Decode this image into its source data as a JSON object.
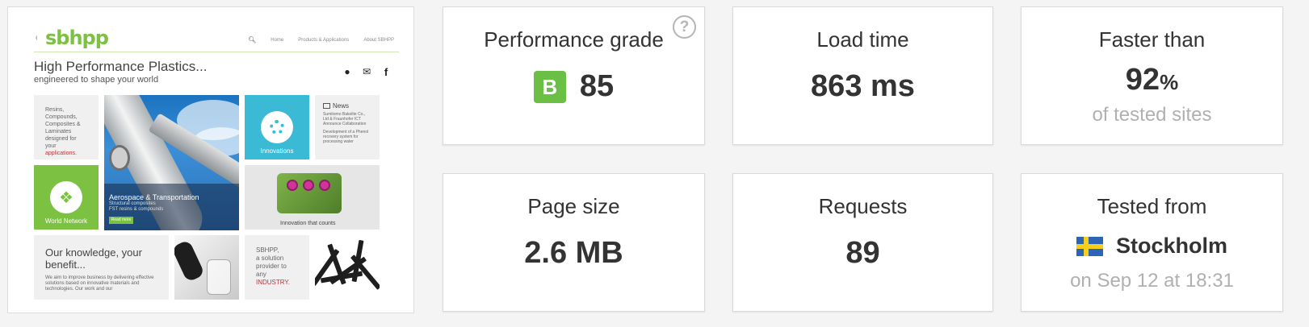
{
  "screenshot": {
    "logo": "sbhpp",
    "nav": [
      "Home",
      "Products & Applications",
      "About SBHPP"
    ],
    "headline": "High Performance Plastics...",
    "tagline": "engineered to shape your world",
    "tile_resins": [
      "Resins,",
      "Compounds,",
      "Composites &",
      "Laminates",
      "designed for",
      "your",
      "applications."
    ],
    "tile_plane_caption": "Aerospace & Transportation",
    "tile_plane_sub": [
      "Structural composites",
      "FST resins & compounds"
    ],
    "tile_plane_button": "Read more",
    "tile_innovations": "Innovations",
    "tile_news_heading": "News",
    "tile_news_items": [
      "Sumitomo Bakelite Co., Ltd & Fraunhofer ICT Announce Collaboration",
      "Development of a Phenol recovery system for processing water"
    ],
    "tile_world": "World Network",
    "tile_engine_caption": "Innovation that counts",
    "tile_knowledge_title": "Our knowledge, your benefit...",
    "tile_knowledge_body": "We aim to improve business by delivering effective solutions based on innovative materials and technologies. Our work and our",
    "tile_solution": [
      "SBHPP,",
      "a solution",
      "provider to",
      "any",
      "INDUSTRY."
    ]
  },
  "metrics": {
    "performance": {
      "title": "Performance grade",
      "grade": "B",
      "score": "85",
      "help": "?"
    },
    "load_time": {
      "title": "Load time",
      "value": "863 ms"
    },
    "faster_than": {
      "title": "Faster than",
      "value": "92",
      "unit": "%",
      "sub": "of tested sites"
    },
    "page_size": {
      "title": "Page size",
      "value": "2.6 MB"
    },
    "requests": {
      "title": "Requests",
      "value": "89"
    },
    "tested_from": {
      "title": "Tested from",
      "location": "Stockholm",
      "sub": "on Sep 12 at 18:31",
      "flag": "sweden-flag"
    }
  },
  "colors": {
    "grade": "#6cbf45",
    "accent": "#7cc142",
    "muted": "#b0b0b0"
  }
}
